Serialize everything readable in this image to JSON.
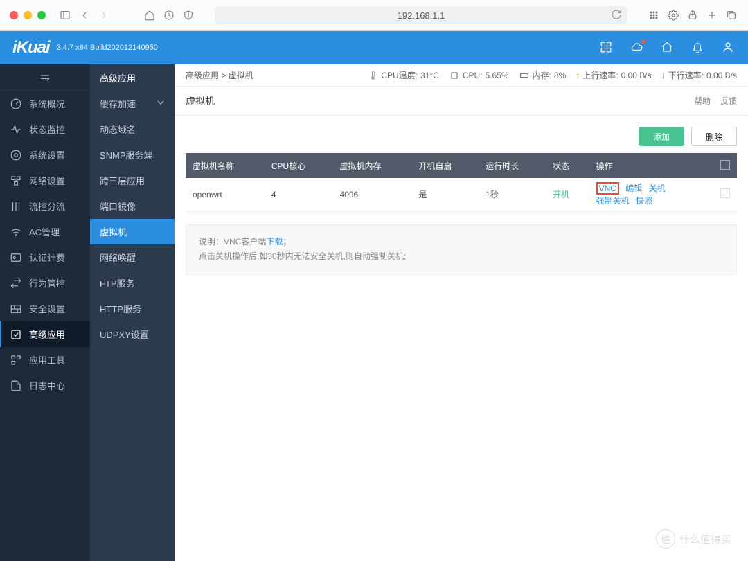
{
  "browser": {
    "url": "192.168.1.1"
  },
  "header": {
    "logo": "iKuai",
    "version": "3.4.7 x64 Build202012140950"
  },
  "sidebar": {
    "items": [
      {
        "label": "系统概况"
      },
      {
        "label": "状态监控"
      },
      {
        "label": "系统设置"
      },
      {
        "label": "网络设置"
      },
      {
        "label": "流控分流"
      },
      {
        "label": "AC管理"
      },
      {
        "label": "认证计费"
      },
      {
        "label": "行为管控"
      },
      {
        "label": "安全设置"
      },
      {
        "label": "高级应用"
      },
      {
        "label": "应用工具"
      },
      {
        "label": "日志中心"
      }
    ]
  },
  "subsidebar": {
    "title": "高级应用",
    "items": [
      {
        "label": "缓存加速",
        "expandable": true
      },
      {
        "label": "动态域名"
      },
      {
        "label": "SNMP服务端"
      },
      {
        "label": "跨三层应用"
      },
      {
        "label": "端口镜像"
      },
      {
        "label": "虚拟机"
      },
      {
        "label": "网络唤醒"
      },
      {
        "label": "FTP服务"
      },
      {
        "label": "HTTP服务"
      },
      {
        "label": "UDPXY设置"
      }
    ]
  },
  "breadcrumb": {
    "parent": "高级应用",
    "current": "虚拟机"
  },
  "stats": {
    "cpu_temp_label": "CPU温度:",
    "cpu_temp": "31°C",
    "cpu_label": "CPU:",
    "cpu": "5.65%",
    "mem_label": "内存:",
    "mem": "8%",
    "up_label": "上行速率:",
    "up": "0.00 B/s",
    "down_label": "下行速率:",
    "down": "0.00 B/s"
  },
  "page": {
    "title": "虚拟机",
    "help": "帮助",
    "feedback": "反馈"
  },
  "buttons": {
    "add": "添加",
    "delete": "删除"
  },
  "table": {
    "headers": [
      "虚拟机名称",
      "CPU核心",
      "虚拟机内存",
      "开机自启",
      "运行时长",
      "状态",
      "操作"
    ],
    "row": {
      "name": "openwrt",
      "cores": "4",
      "memory": "4096",
      "autostart": "是",
      "uptime": "1秒",
      "status": "开机",
      "actions": {
        "vnc": "VNC",
        "edit": "编辑",
        "shutdown": "关机",
        "force": "强制关机",
        "snapshot": "快照"
      }
    }
  },
  "note": {
    "label": "说明：",
    "line1a": "VNC客户端",
    "download": "下载",
    "line1b": "；",
    "line2": "点击关机操作后,如30秒内无法安全关机,则自动强制关机;"
  },
  "watermark": {
    "icon": "值",
    "text": "什么值得买"
  }
}
